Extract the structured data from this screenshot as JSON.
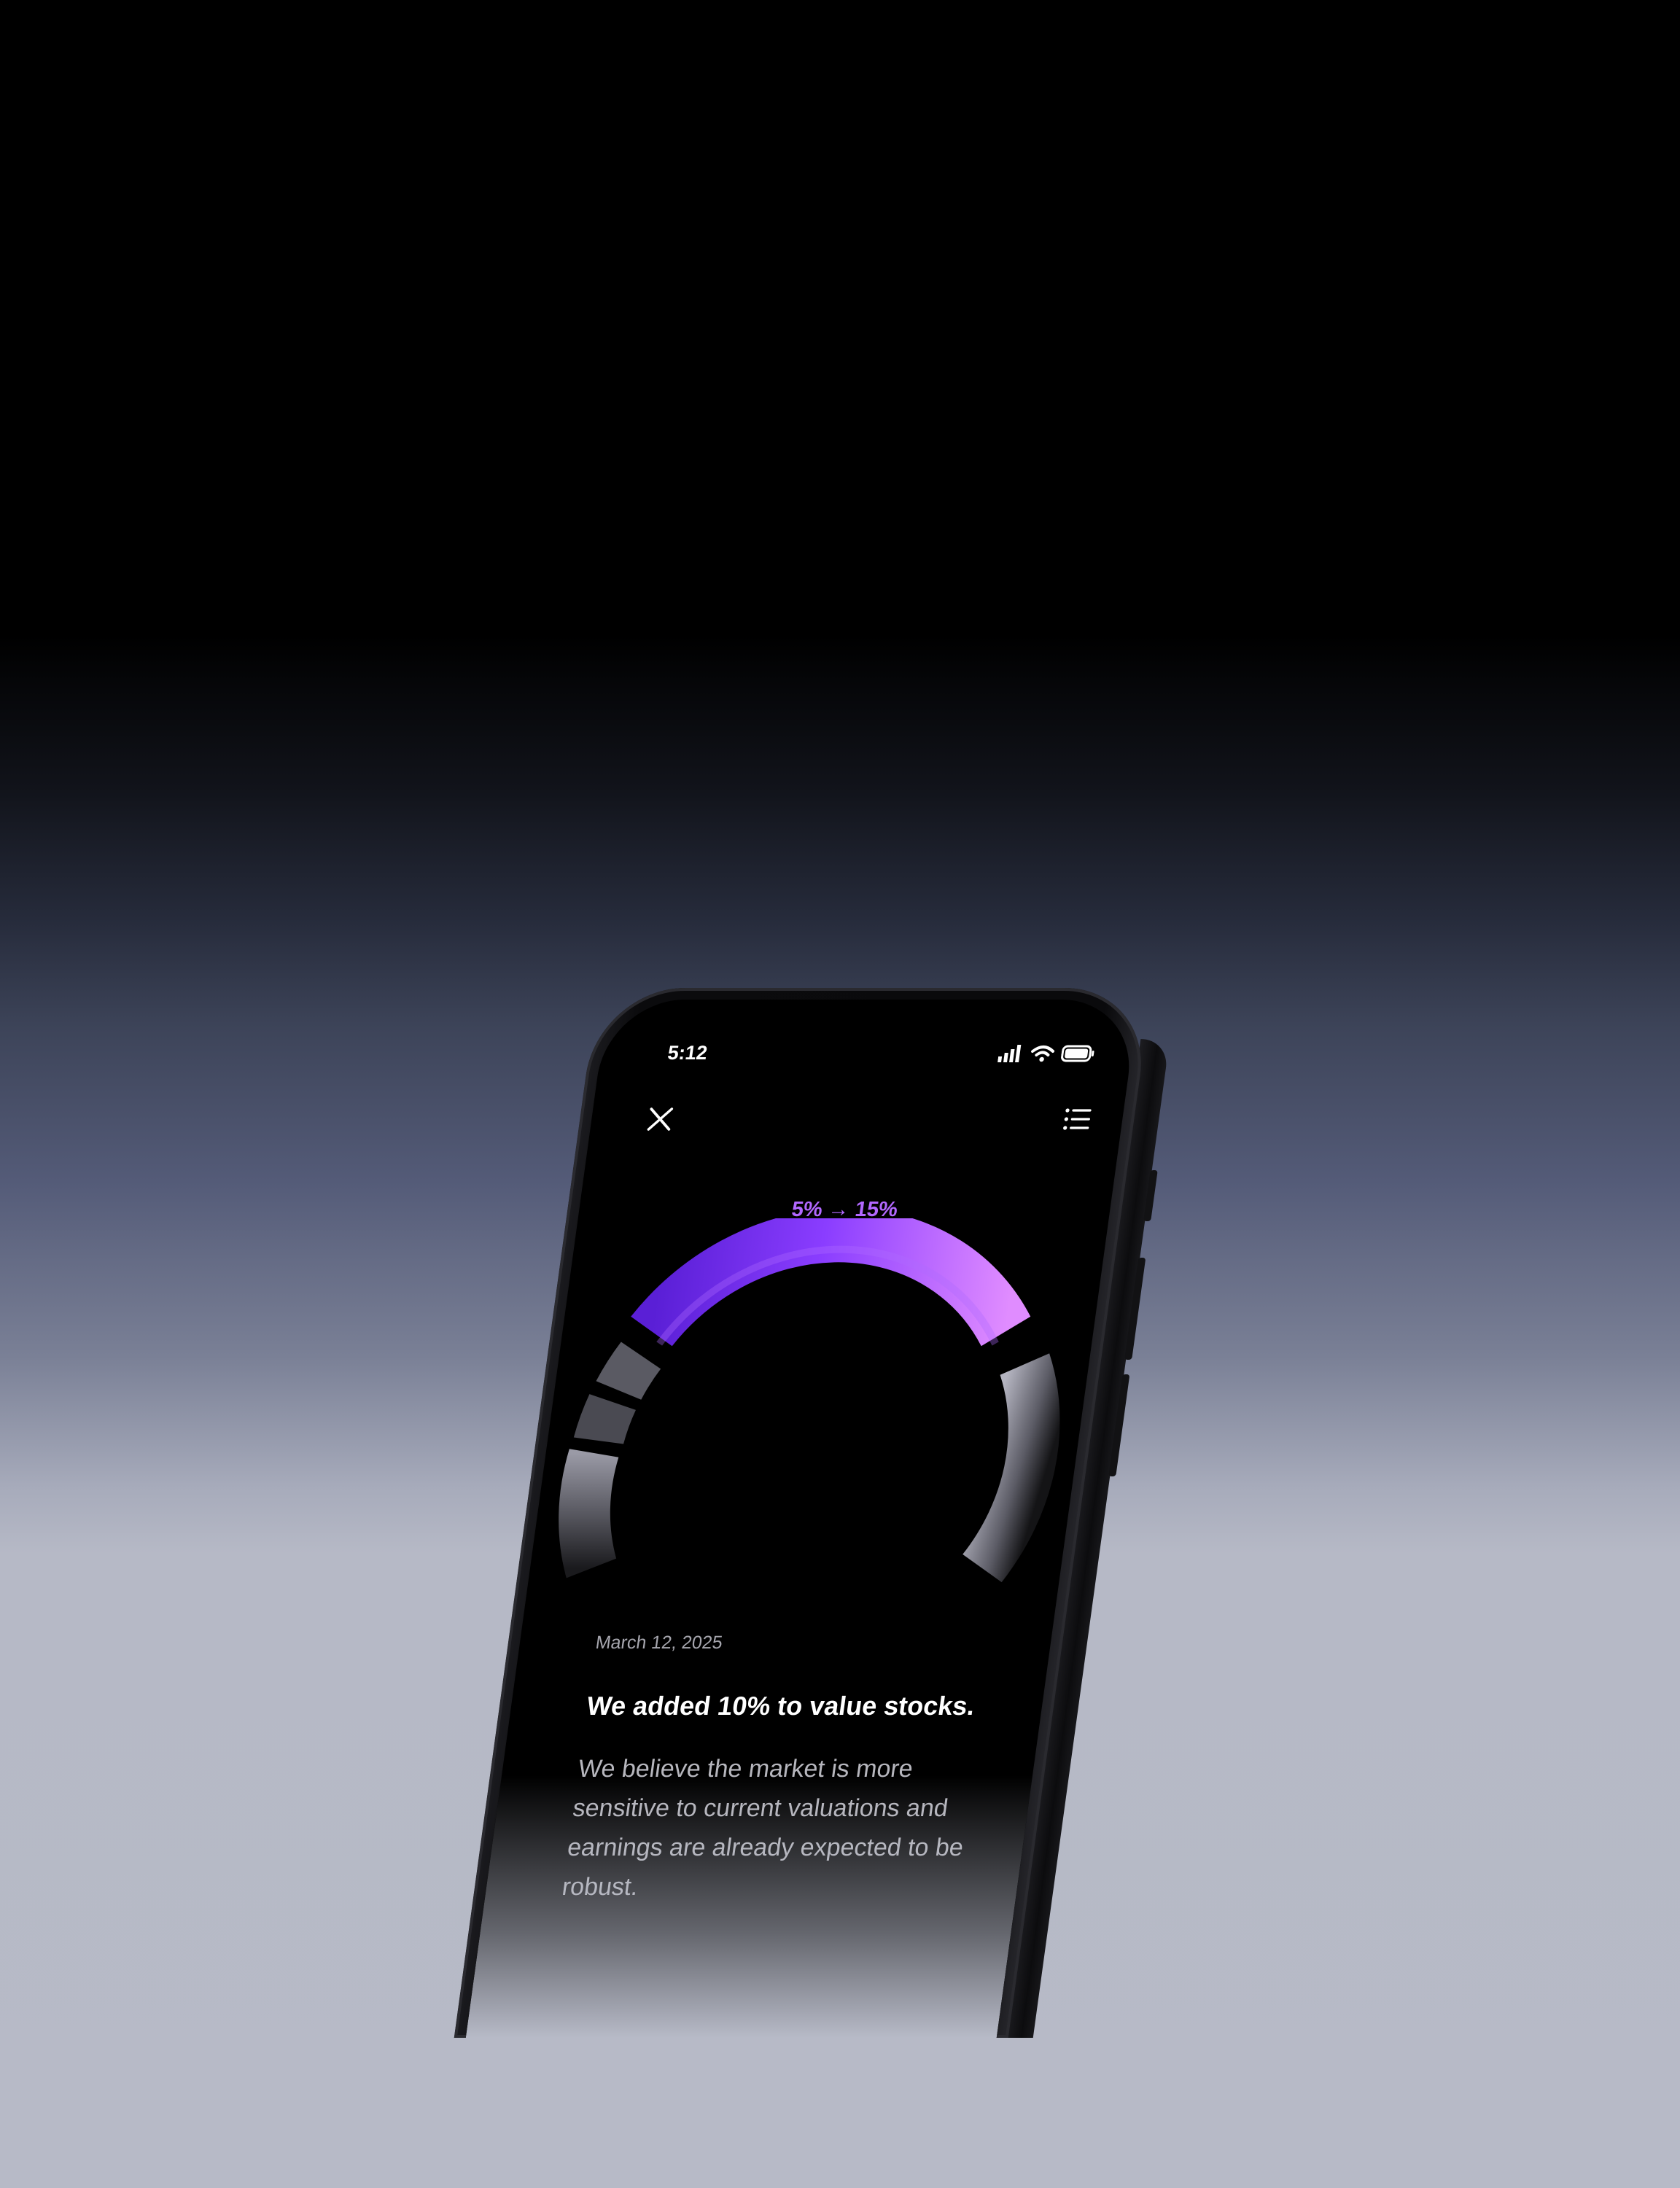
{
  "status_bar": {
    "time": "5:12"
  },
  "header": {
    "close_icon": "close-icon",
    "list_icon": "list-icon"
  },
  "allocation": {
    "change_label": "5% → 15%",
    "accent_color": "#8a3dff",
    "highlight_color": "#d77cff"
  },
  "update": {
    "date": "March 12, 2025",
    "headline": "We added 10% to value stocks.",
    "body": "We believe the market is more sensitive to current valuations and earnings are already expected to be robust."
  }
}
